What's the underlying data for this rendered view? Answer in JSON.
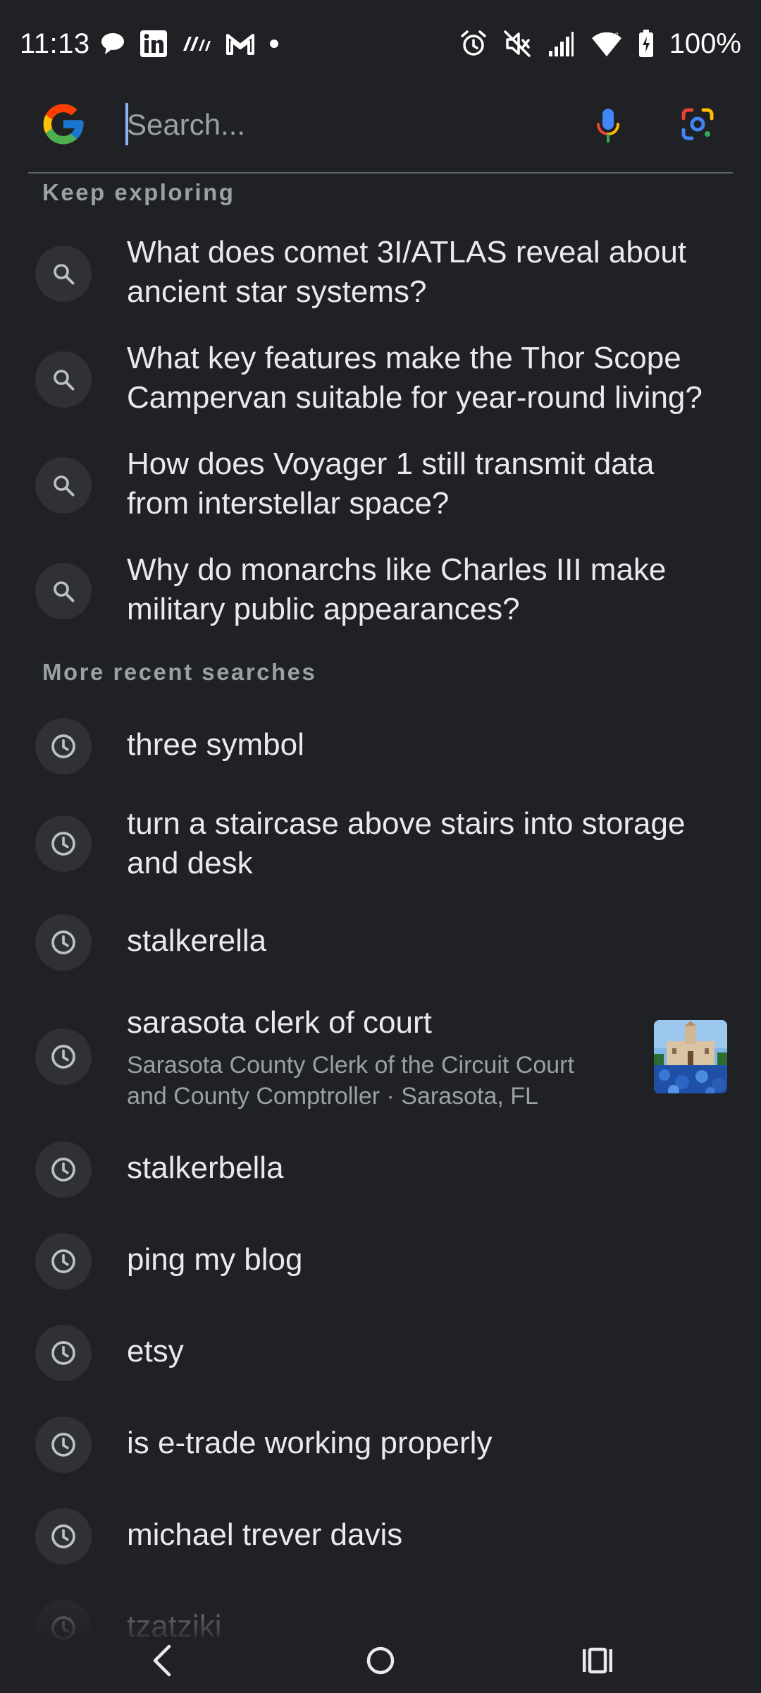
{
  "status_bar": {
    "time": "11:13",
    "battery": "100%",
    "icons_left": [
      "chat-bubble-icon",
      "linkedin-icon",
      "medium-icon",
      "gmail-icon",
      "dot-icon"
    ],
    "icons_right": [
      "alarm-icon",
      "mute-icon",
      "signal-icon",
      "wifi-icon",
      "battery-icon"
    ]
  },
  "search": {
    "placeholder": "Search...",
    "value": ""
  },
  "sections": {
    "keep_exploring": "Keep exploring",
    "recent": "More recent searches"
  },
  "explore_items": [
    {
      "line1": "What does comet 3I/ATLAS reveal about",
      "line2": "ancient star systems?"
    },
    {
      "line1": "What key features make the Thor Scope",
      "line2": "Campervan suitable for year-round living?"
    },
    {
      "line1": "How does Voyager 1 still transmit data",
      "line2": "from interstellar space?"
    },
    {
      "line1": "Why do monarchs like Charles III make",
      "line2": "military public appearances?"
    }
  ],
  "recent_items": [
    {
      "line1": "three symbol"
    },
    {
      "line1": "turn a staircase above stairs into storage",
      "line2": "and desk"
    },
    {
      "line1": "stalkerella"
    },
    {
      "line1": "sarasota clerk of court",
      "sub1": "Sarasota County Clerk of the Circuit Court",
      "sub2": "and County Comptroller · Sarasota, FL"
    },
    {
      "line1": "stalkerbella"
    },
    {
      "line1": "ping my blog"
    },
    {
      "line1": "etsy"
    },
    {
      "line1": "is e-trade working properly"
    },
    {
      "line1": "michael trever davis"
    },
    {
      "line1": "tzatziki"
    }
  ],
  "colors": {
    "background": "#202124",
    "text_primary": "#e8eaed",
    "text_secondary": "#9aa0a6",
    "icon_circle": "#303134",
    "accent": "#8ab4f8"
  }
}
